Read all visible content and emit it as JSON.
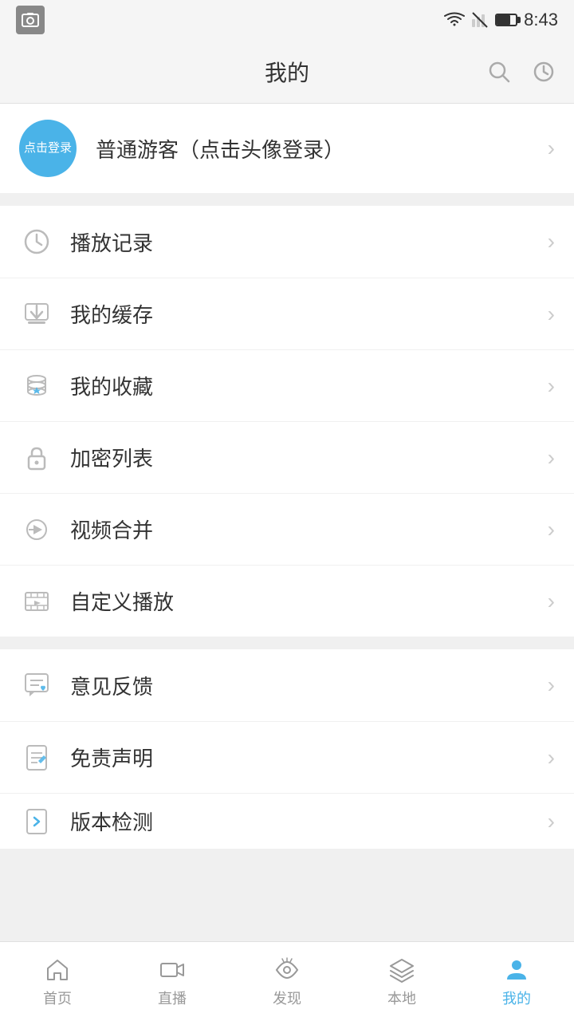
{
  "statusBar": {
    "time": "8:43"
  },
  "header": {
    "title": "我的",
    "searchLabel": "搜索",
    "historyLabel": "历史"
  },
  "profile": {
    "avatarText": "点击登录",
    "name": "普通游客（点击头像登录）"
  },
  "menuGroups": [
    {
      "id": "group1",
      "items": [
        {
          "id": "play-history",
          "label": "播放记录",
          "icon": "clock"
        },
        {
          "id": "my-cache",
          "label": "我的缓存",
          "icon": "download"
        },
        {
          "id": "my-favorites",
          "label": "我的收藏",
          "icon": "database-star"
        },
        {
          "id": "encrypted-list",
          "label": "加密列表",
          "icon": "lock"
        },
        {
          "id": "video-merge",
          "label": "视频合并",
          "icon": "merge"
        },
        {
          "id": "custom-play",
          "label": "自定义播放",
          "icon": "film"
        }
      ]
    },
    {
      "id": "group2",
      "items": [
        {
          "id": "feedback",
          "label": "意见反馈",
          "icon": "feedback"
        },
        {
          "id": "disclaimer",
          "label": "免责声明",
          "icon": "disclaimer"
        },
        {
          "id": "version-check",
          "label": "版本检测",
          "icon": "version",
          "partial": true
        }
      ]
    }
  ],
  "bottomNav": {
    "items": [
      {
        "id": "home",
        "label": "首页",
        "icon": "home",
        "active": false
      },
      {
        "id": "live",
        "label": "直播",
        "icon": "video",
        "active": false
      },
      {
        "id": "discover",
        "label": "发现",
        "icon": "eye",
        "active": false
      },
      {
        "id": "local",
        "label": "本地",
        "icon": "layers",
        "active": false
      },
      {
        "id": "mine",
        "label": "我的",
        "icon": "user",
        "active": true
      }
    ]
  }
}
